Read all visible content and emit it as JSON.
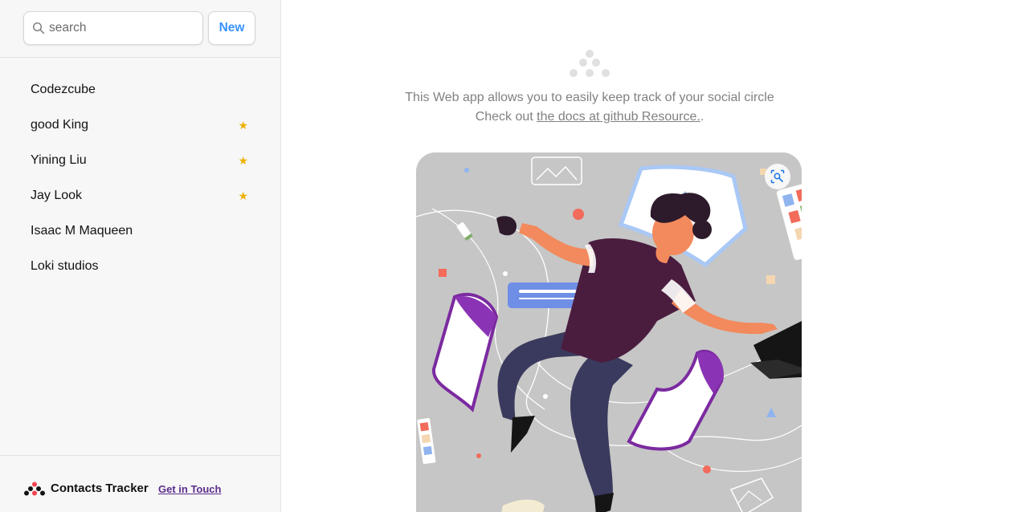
{
  "search": {
    "placeholder": "search",
    "value": ""
  },
  "new_button_label": "New",
  "contacts": [
    {
      "name": "Codezcube",
      "favorite": false
    },
    {
      "name": "good King",
      "favorite": true
    },
    {
      "name": "Yining Liu",
      "favorite": true
    },
    {
      "name": "Jay Look",
      "favorite": true
    },
    {
      "name": "Isaac M Maqueen",
      "favorite": false
    },
    {
      "name": "Loki studios",
      "favorite": false
    }
  ],
  "star_glyph": "★",
  "footer": {
    "brand": "Contacts Tracker",
    "link": "Get in Touch"
  },
  "main": {
    "intro_line1": "This Web app allows you to easily keep track of your social circle",
    "intro_prefix": "Check out ",
    "docs_link": "the docs at github Resource.",
    "intro_suffix": "."
  },
  "colors": {
    "accent": "#3992ff",
    "star": "#eeb004",
    "link_visited": "#5b2d8c",
    "brand_red": "#f44250"
  },
  "icons": {
    "search": "search-icon",
    "logo": "contacts-logo-icon",
    "lens": "visual-search-icon"
  }
}
